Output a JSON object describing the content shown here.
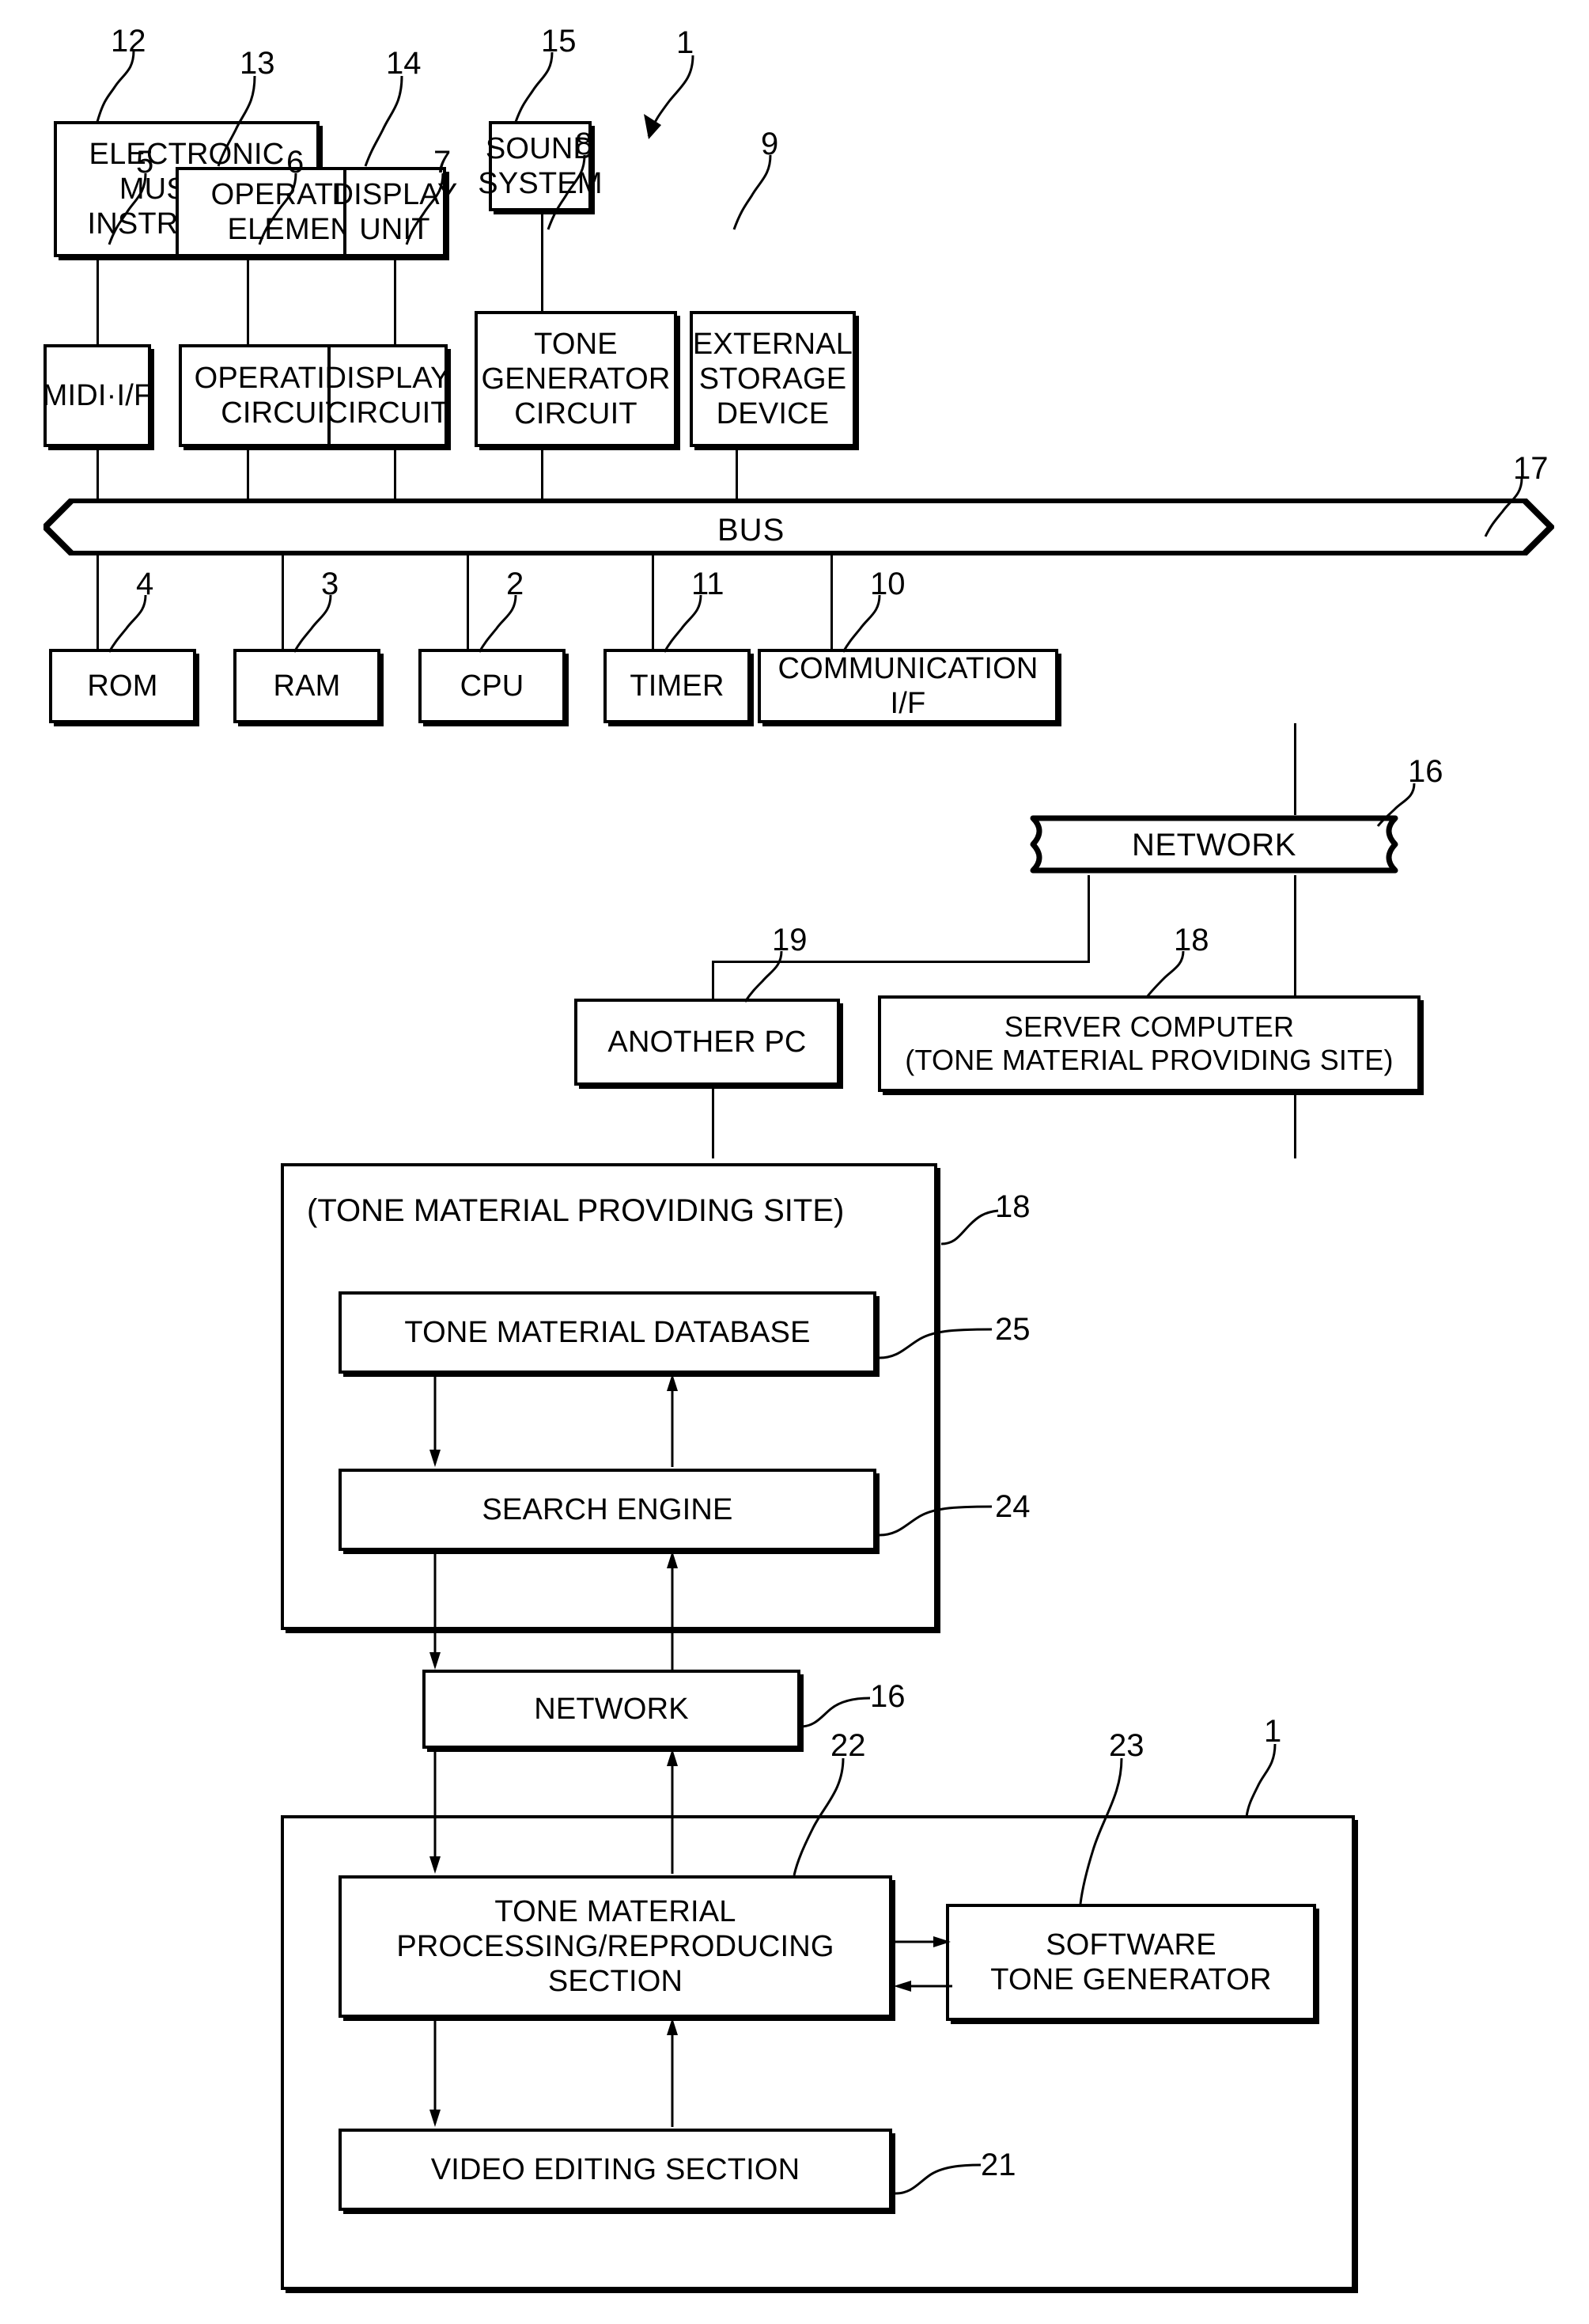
{
  "figure1": {
    "top_row": [
      {
        "label": "ELECTRONIC\nMUSICAL\nINSTRUMENT",
        "ref": "12"
      },
      {
        "label": "OPERATING\nELEMENT",
        "ref": "13"
      },
      {
        "label": "DISPLAY\nUNIT",
        "ref": "14"
      },
      {
        "label": "SOUND\nSYSTEM",
        "ref": "15"
      }
    ],
    "system_ref": "1",
    "middle_row": [
      {
        "label": "MIDI·I/F",
        "ref": "5"
      },
      {
        "label": "OPERATING\nCIRCUIT",
        "ref": "6"
      },
      {
        "label": "DISPLAY\nCIRCUIT",
        "ref": "7"
      },
      {
        "label": "TONE\nGENERATOR\nCIRCUIT",
        "ref": "8"
      },
      {
        "label": "EXTERNAL\nSTORAGE\nDEVICE",
        "ref": "9"
      }
    ],
    "bus": {
      "label": "BUS",
      "ref": "17"
    },
    "bottom_row": [
      {
        "label": "ROM",
        "ref": "4"
      },
      {
        "label": "RAM",
        "ref": "3"
      },
      {
        "label": "CPU",
        "ref": "2"
      },
      {
        "label": "TIMER",
        "ref": "11"
      },
      {
        "label": "COMMUNICATION\nI/F",
        "ref": "10"
      }
    ],
    "network": {
      "label": "NETWORK",
      "ref": "16"
    },
    "another_pc": {
      "label": "ANOTHER PC",
      "ref": "19"
    },
    "server": {
      "label": "SERVER COMPUTER\n(TONE MATERIAL PROVIDING SITE)",
      "ref": "18"
    }
  },
  "figure2": {
    "site": {
      "title": "(TONE MATERIAL PROVIDING SITE)",
      "ref": "18",
      "database": {
        "label": "TONE MATERIAL DATABASE",
        "ref": "25"
      },
      "search_engine": {
        "label": "SEARCH ENGINE",
        "ref": "24"
      }
    },
    "network": {
      "label": "NETWORK",
      "ref": "16"
    },
    "client": {
      "ref": "1",
      "processing": {
        "label": "TONE MATERIAL\nPROCESSING/REPRODUCING\nSECTION",
        "ref": "22"
      },
      "software_tg": {
        "label": "SOFTWARE\nTONE GENERATOR",
        "ref": "23"
      },
      "video_editing": {
        "label": "VIDEO EDITING SECTION",
        "ref": "21"
      }
    }
  }
}
